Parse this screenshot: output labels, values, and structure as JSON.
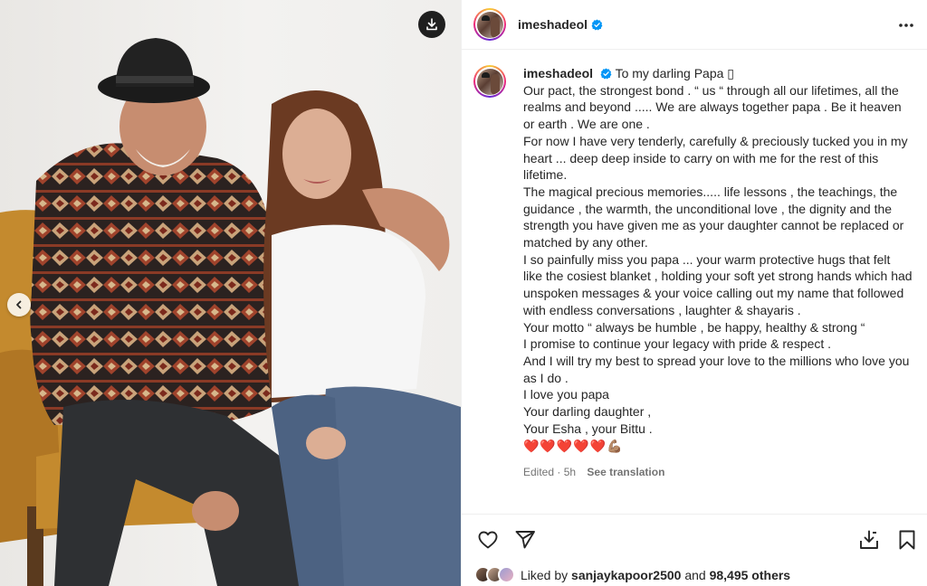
{
  "post": {
    "username": "imeshadeol",
    "verified": true
  },
  "media": {
    "download_icon": "download-icon",
    "prev_icon": "chevron-left-icon"
  },
  "caption": {
    "lead": "To my darling Papa ▯",
    "lines": [
      "Our pact, the strongest bond . “ us “ through all our lifetimes, all the realms and beyond ..... We are always together papa . Be it heaven or earth . We are one .",
      "For now I have very tenderly, carefully & preciously tucked you in my heart ... deep deep inside to carry on with me for the rest of this lifetime.",
      "The magical precious memories..... life lessons , the teachings, the guidance , the warmth, the unconditional love , the dignity and the strength you have given me as your daughter cannot be replaced or matched by any other.",
      "I so painfully miss you papa ... your warm protective hugs that felt like the cosiest blanket , holding your soft yet strong hands which had unspoken messages & your voice calling out my name that followed with endless conversations , laughter & shayaris .",
      "Your motto “ always be humble , be happy, healthy & strong “",
      "I promise to continue your legacy with pride & respect .",
      "And I will try my best to spread your love to the millions who love you as I do .",
      "I love you papa",
      "Your darling daughter ,",
      "Your Esha , your Bittu ."
    ],
    "emojis": "❤️❤️❤️❤️❤️💪🏽",
    "edited": "Edited · 5h",
    "see_translation": "See translation"
  },
  "likes": {
    "prefix": "Liked by",
    "user": "sanjaykapoor2500",
    "middle": "and",
    "count": "98,495 others"
  },
  "colors": {
    "text": "#262626",
    "muted": "#737373",
    "verified": "#0095f6",
    "heart": "#e0245e",
    "border": "#efefef"
  }
}
